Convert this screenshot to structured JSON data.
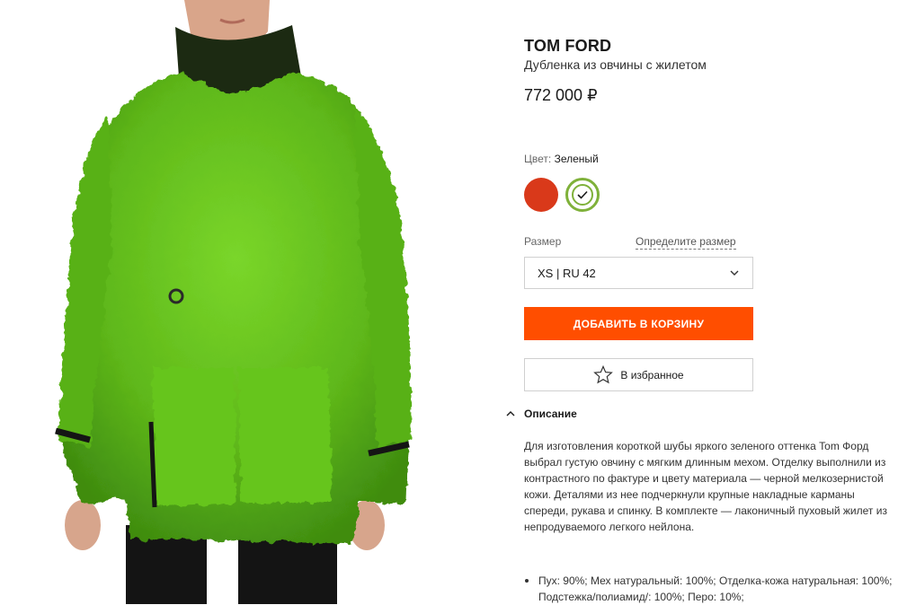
{
  "product": {
    "brand": "TOM FORD",
    "name": "Дубленка из овчины с жилетом",
    "price": "772 000 ₽"
  },
  "color": {
    "label": "Цвет:",
    "selected": "Зеленый",
    "swatches": [
      {
        "name": "red",
        "hex": "#d9391a"
      },
      {
        "name": "green",
        "hex": "#7fb13a",
        "selected": true
      }
    ]
  },
  "size": {
    "label": "Размер",
    "guide_link": "Определите размер",
    "selected": "XS | RU 42"
  },
  "actions": {
    "add_to_cart": "ДОБАВИТЬ В КОРЗИНУ",
    "favorite": "В избранное"
  },
  "description": {
    "heading": "Описание",
    "text": "Для изготовления короткой шубы яркого зеленого оттенка Tom Форд выбрал густую овчину с мягким длинным мехом. Отделку выполнили из контрастного по фактуре и цвету материала — черной мелкозернистой кожи. Деталями из нее подчеркнули крупные накладные карманы спереди, рукава и спинку. В комплекте — лаконичный пуховый жилет из непродуваемого легкого нейлона.",
    "composition": "Пух: 90%; Мех натуральный: 100%; Отделка-кожа натуральная: 100%; Подстежка/полиамид/: 100%; Перо: 10%;"
  },
  "colors": {
    "accent": "#ff4e00",
    "fur_green": "#6cc21b"
  }
}
